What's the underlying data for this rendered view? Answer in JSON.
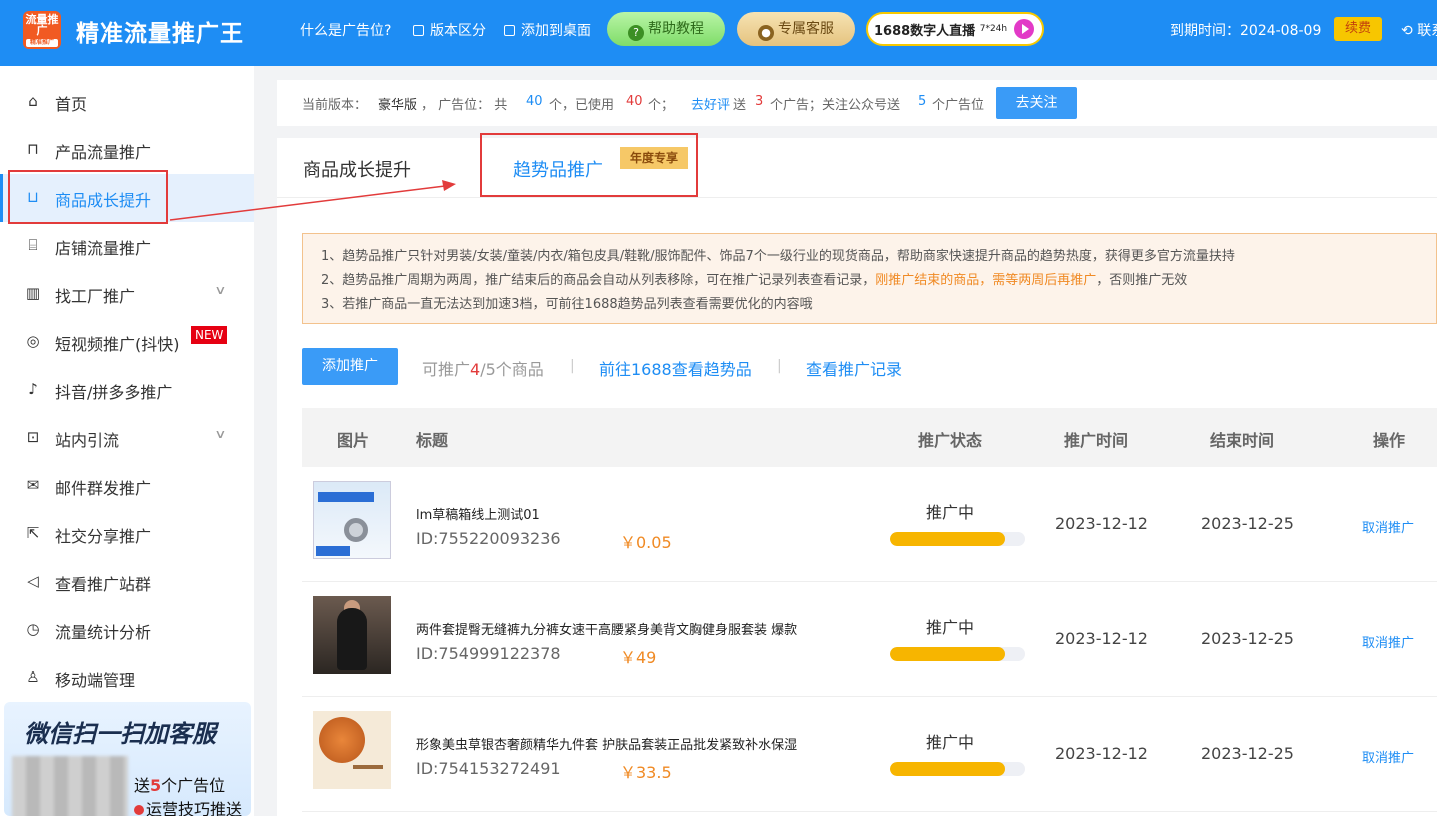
{
  "header": {
    "logo_text": "流量推广",
    "logo_sub": "精准推广",
    "app_title": "精准流量推广王",
    "links": [
      "什么是广告位?",
      "版本区分",
      "添加到桌面"
    ],
    "help_button": "帮助教程",
    "service_button": "专属客服",
    "live_button": "1688数字人直播",
    "live_sup": "7*24h",
    "expire_label": "到期时间：2024-08-09",
    "renew_button": "续费",
    "contact": "联系"
  },
  "sidebar": {
    "items": [
      {
        "label": "首页",
        "icon": "home-icon"
      },
      {
        "label": "产品流量推广",
        "icon": "bag-icon"
      },
      {
        "label": "商品成长提升",
        "icon": "basket-icon",
        "active": true
      },
      {
        "label": "店铺流量推广",
        "icon": "store-icon"
      },
      {
        "label": "找工厂推广",
        "icon": "factory-icon",
        "expandable": true
      },
      {
        "label": "短视频推广(抖快)",
        "icon": "instagram-icon",
        "badge": "NEW"
      },
      {
        "label": "抖音/拼多多推广",
        "icon": "tiktok-icon"
      },
      {
        "label": "站内引流",
        "icon": "chart-icon",
        "expandable": true
      },
      {
        "label": "邮件群发推广",
        "icon": "mail-icon"
      },
      {
        "label": "社交分享推广",
        "icon": "share-icon"
      },
      {
        "label": "查看推广站群",
        "icon": "megaphone-icon"
      },
      {
        "label": "流量统计分析",
        "icon": "stats-icon"
      },
      {
        "label": "移动端管理",
        "icon": "user-icon"
      }
    ],
    "promo": {
      "title": "微信扫一扫加客服",
      "line1_pre": "送",
      "line1_num": "5",
      "line1_post": "个广告位",
      "line2": "运营技巧推送"
    }
  },
  "info_bar": {
    "version_label": "当前版本：",
    "version": "豪华版",
    "ad_label": "，  广告位：  共",
    "total": "40",
    "used_label": "个，已使用",
    "used": "40",
    "unit": "个；",
    "review_link": "去好评",
    "review_text": "送",
    "review_num": "3",
    "review_post": "个广告；关注公众号送",
    "follow_num": "5",
    "follow_post": "个广告位",
    "follow_button": "去关注"
  },
  "tabs": {
    "tab1": "商品成长提升",
    "tab2": "趋势品推广",
    "tab2_tag": "年度专享"
  },
  "notice": {
    "line1": "1、趋势品推广只针对男装/女装/童装/内衣/箱包皮具/鞋靴/服饰配件、饰品7个一级行业的现货商品，帮助商家快速提升商品的趋势热度，获得更多官方流量扶持",
    "line2_pre": "2、趋势品推广周期为两周，推广结束后的商品会自动从列表移除，可在推广记录列表查看记录，",
    "line2_orange": "刚推广结束的商品，需等两周后再推广",
    "line2_post": "，否则推广无效",
    "line3": "3、若推广商品一直无法达到加速3档，可前往1688趋势品列表查看需要优化的内容哦"
  },
  "toolbar": {
    "add_button": "添加推广",
    "quota_pre": "可推广",
    "quota_used": "4",
    "quota_post": "/5个商品",
    "link_trend": "前往1688查看趋势品",
    "link_records": "查看推广记录",
    "separator": "|"
  },
  "table": {
    "headers": [
      "图片",
      "标题",
      "推广状态",
      "推广时间",
      "结束时间",
      "操作"
    ],
    "rows": [
      {
        "title": "lm草稿箱线上测试01",
        "id": "ID:755220093236",
        "price": "￥0.05",
        "status": "推广中",
        "progress": 0.85,
        "start": "2023-12-12",
        "end": "2023-12-25",
        "action": "取消推广"
      },
      {
        "title": "两件套提臀无缝裤九分裤女速干高腰紧身美背文胸健身服套装 爆款",
        "id": "ID:754999122378",
        "price": "￥49",
        "status": "推广中",
        "progress": 0.85,
        "start": "2023-12-12",
        "end": "2023-12-25",
        "action": "取消推广"
      },
      {
        "title": "形象美虫草银杏奢颜精华九件套 护肤品套装正品批发紧致补水保湿",
        "id": "ID:754153272491",
        "price": "￥33.5",
        "status": "推广中",
        "progress": 0.85,
        "start": "2023-12-12",
        "end": "2023-12-25",
        "action": "取消推广"
      }
    ]
  },
  "colors": {
    "header_bg": "#1e8df4",
    "accent": "#1e8df4",
    "highlight_red": "#e23b3b",
    "progress": "#f7b500",
    "price": "#f08a24"
  }
}
